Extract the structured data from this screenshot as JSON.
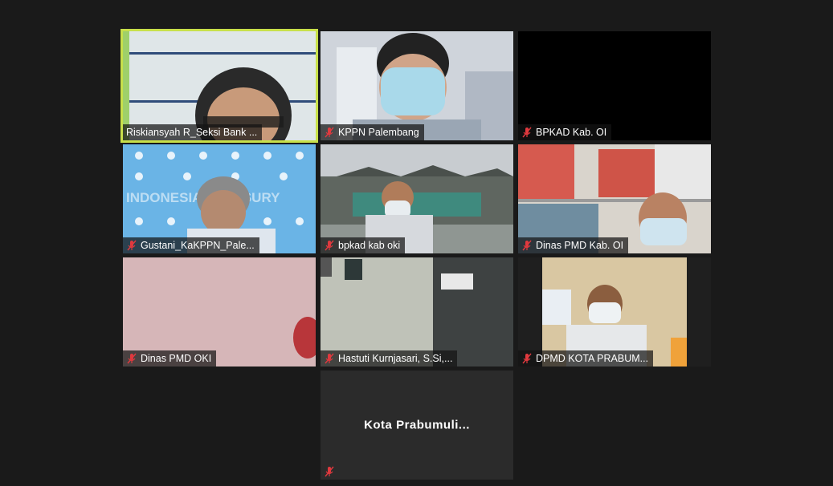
{
  "participants": [
    {
      "name": "Riskiansyah R_Seksi Bank ...",
      "muted": false,
      "active": true
    },
    {
      "name": "KPPN Palembang",
      "muted": true
    },
    {
      "name": "BPKAD Kab. OI",
      "muted": true
    },
    {
      "name": "Gustani_KaKPPN_Pale...",
      "muted": true
    },
    {
      "name": "bpkad kab oki",
      "muted": true
    },
    {
      "name": "Dinas PMD Kab. OI",
      "muted": true
    },
    {
      "name": "Dinas PMD OKI",
      "muted": true
    },
    {
      "name": "Hastuti Kurnjasari, S.Si,...",
      "muted": true
    },
    {
      "name": "DPMD KOTA PRABUM...",
      "muted": true
    },
    {
      "name": "Kota  Prabumuli...",
      "muted": true,
      "video_off": true
    }
  ],
  "background_text": "INDONESIA TREASURY",
  "colors": {
    "active_speaker_border": "#c8e04a",
    "muted_icon": "#e0393e",
    "background": "#1a1a1a"
  }
}
